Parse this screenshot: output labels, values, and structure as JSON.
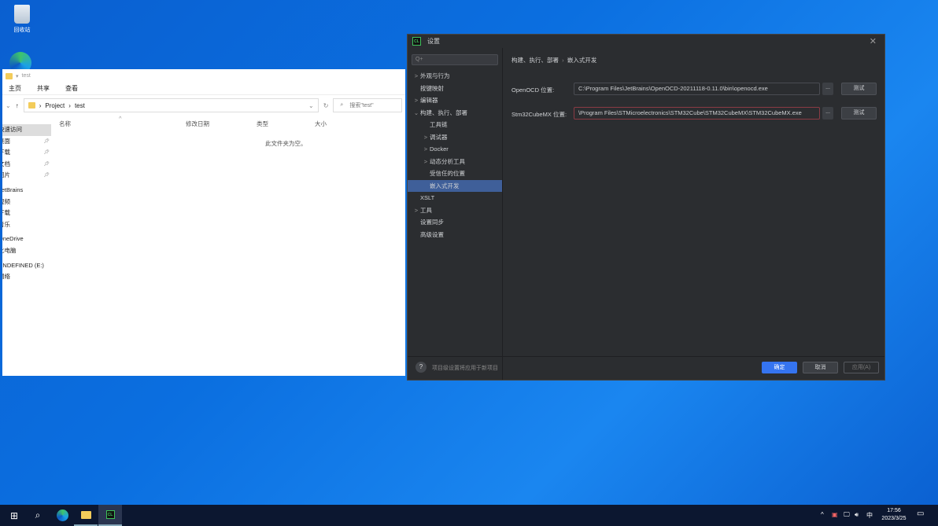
{
  "desktop": {
    "recycle_bin": "回收站"
  },
  "explorer": {
    "title": "test",
    "ribbon": [
      "主页",
      "共享",
      "查看"
    ],
    "path": [
      "Project",
      "test"
    ],
    "search_placeholder": "搜索\"test\"",
    "columns": [
      "名称",
      "修改日期",
      "类型",
      "大小"
    ],
    "empty_text": "此文件夹为空。",
    "nav": [
      {
        "label": "快速访问",
        "pinned": false,
        "selected": true
      },
      {
        "label": "桌面",
        "pinned": true
      },
      {
        "label": "下载",
        "pinned": true
      },
      {
        "label": "文档",
        "pinned": true
      },
      {
        "label": "图片",
        "pinned": true
      },
      {
        "label": "JetBrains"
      },
      {
        "label": "视频"
      },
      {
        "label": "下载"
      },
      {
        "label": "音乐"
      },
      {
        "label": "OneDrive"
      },
      {
        "label": "此电脑"
      },
      {
        "label": "UNDEFINED (E:)"
      },
      {
        "label": "网络"
      }
    ]
  },
  "dialog": {
    "title": "设置",
    "search_placeholder": "Q+",
    "breadcrumb": [
      "构建、执行、部署",
      "嵌入式开发"
    ],
    "tree": [
      {
        "label": "外观与行为",
        "arrow": ">",
        "level": 0
      },
      {
        "label": "按键映射",
        "arrow": "",
        "level": 0
      },
      {
        "label": "编辑器",
        "arrow": ">",
        "level": 0
      },
      {
        "label": "构建、执行、部署",
        "arrow": "v",
        "level": 0
      },
      {
        "label": "工具链",
        "arrow": "",
        "level": 1
      },
      {
        "label": "调试器",
        "arrow": ">",
        "level": 1
      },
      {
        "label": "Docker",
        "arrow": ">",
        "level": 1
      },
      {
        "label": "动态分析工具",
        "arrow": ">",
        "level": 1
      },
      {
        "label": "受信任的位置",
        "arrow": "",
        "level": 1
      },
      {
        "label": "嵌入式开发",
        "arrow": "",
        "level": 1,
        "selected": true
      },
      {
        "label": "XSLT",
        "arrow": "",
        "level": 0
      },
      {
        "label": "工具",
        "arrow": ">",
        "level": 0
      },
      {
        "label": "设置同步",
        "arrow": "",
        "level": 0
      },
      {
        "label": "高级设置",
        "arrow": "",
        "level": 0
      }
    ],
    "openocd_label": "OpenOCD 位置:",
    "openocd_value": "C:\\Program Files\\JetBrains\\OpenOCD-20211118-0.11.0\\bin\\openocd.exe",
    "cubemx_label": "Stm32CubeMX 位置:",
    "cubemx_value": "\\Program Files\\STMicroelectronics\\STM32Cube\\STM32CubeMX\\STM32CubeMX.exe",
    "browse": "...",
    "test": "测试",
    "footer_hint": "项目级设置将应用于新项目",
    "ok": "确定",
    "cancel": "取消",
    "apply": "应用(A)"
  },
  "taskbar": {
    "time": "17:56",
    "date": "2023/3/25",
    "ime": "中"
  }
}
